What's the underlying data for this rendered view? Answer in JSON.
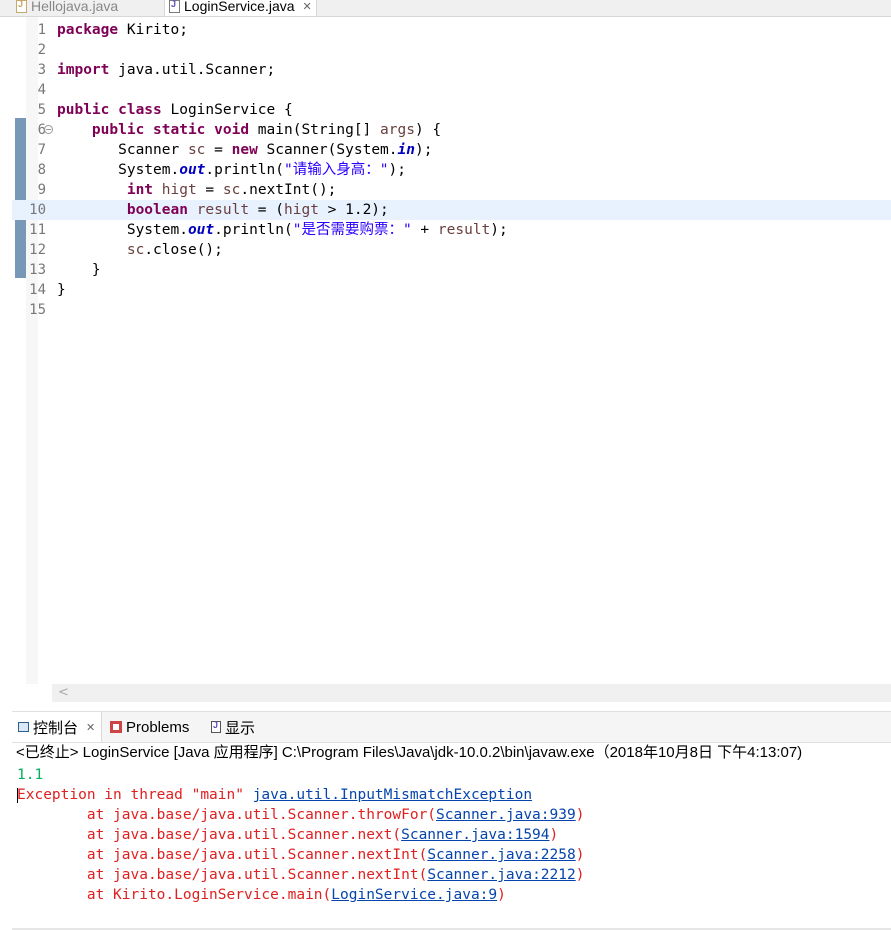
{
  "editor_tabs": [
    {
      "label": "Hellojava.java",
      "active": false,
      "icon": "java-file-icon"
    },
    {
      "label": "LoginService.java",
      "active": true,
      "icon": "java-file-icon",
      "close": "✕"
    }
  ],
  "code_lines": [
    {
      "n": "1",
      "tokens": [
        {
          "t": "kw",
          "v": "package"
        },
        {
          "t": "p",
          "v": " Kirito;"
        }
      ]
    },
    {
      "n": "2",
      "tokens": []
    },
    {
      "n": "3",
      "tokens": [
        {
          "t": "kw",
          "v": "import"
        },
        {
          "t": "p",
          "v": " java.util.Scanner;"
        }
      ]
    },
    {
      "n": "4",
      "tokens": []
    },
    {
      "n": "5",
      "tokens": [
        {
          "t": "kw",
          "v": "public class"
        },
        {
          "t": "p",
          "v": " LoginService {"
        }
      ]
    },
    {
      "n": "6",
      "fold": "−",
      "tokens": [
        {
          "t": "p",
          "v": "    "
        },
        {
          "t": "kw",
          "v": "public static void"
        },
        {
          "t": "p",
          "v": " main(String[] "
        },
        {
          "t": "var",
          "v": "args"
        },
        {
          "t": "p",
          "v": ") {"
        }
      ]
    },
    {
      "n": "7",
      "tokens": [
        {
          "t": "p",
          "v": "       Scanner "
        },
        {
          "t": "var",
          "v": "sc"
        },
        {
          "t": "p",
          "v": " = "
        },
        {
          "t": "kw",
          "v": "new"
        },
        {
          "t": "p",
          "v": " Scanner(System."
        },
        {
          "t": "fld",
          "v": "in"
        },
        {
          "t": "p",
          "v": ");"
        }
      ]
    },
    {
      "n": "8",
      "tokens": [
        {
          "t": "p",
          "v": "       System."
        },
        {
          "t": "fld",
          "v": "out"
        },
        {
          "t": "p",
          "v": ".println("
        },
        {
          "t": "str",
          "v": "\"请输入身高：\""
        },
        {
          "t": "p",
          "v": ");"
        }
      ]
    },
    {
      "n": "9",
      "tokens": [
        {
          "t": "p",
          "v": "        "
        },
        {
          "t": "kw",
          "v": "int"
        },
        {
          "t": "p",
          "v": " "
        },
        {
          "t": "var",
          "v": "higt"
        },
        {
          "t": "p",
          "v": " = "
        },
        {
          "t": "var",
          "v": "sc"
        },
        {
          "t": "p",
          "v": ".nextInt();"
        }
      ]
    },
    {
      "n": "10",
      "current": true,
      "tokens": [
        {
          "t": "p",
          "v": "        "
        },
        {
          "t": "kw",
          "v": "boolean"
        },
        {
          "t": "p",
          "v": " "
        },
        {
          "t": "var",
          "v": "result"
        },
        {
          "t": "p",
          "v": " = ("
        },
        {
          "t": "var",
          "v": "higt"
        },
        {
          "t": "p",
          "v": " > 1.2);"
        }
      ]
    },
    {
      "n": "11",
      "tokens": [
        {
          "t": "p",
          "v": "        System."
        },
        {
          "t": "fld",
          "v": "out"
        },
        {
          "t": "p",
          "v": ".println("
        },
        {
          "t": "str",
          "v": "\"是否需要购票：\""
        },
        {
          "t": "p",
          "v": " + "
        },
        {
          "t": "var",
          "v": "result"
        },
        {
          "t": "p",
          "v": ");"
        }
      ]
    },
    {
      "n": "12",
      "tokens": [
        {
          "t": "p",
          "v": "        "
        },
        {
          "t": "var",
          "v": "sc"
        },
        {
          "t": "p",
          "v": ".close();"
        }
      ]
    },
    {
      "n": "13",
      "tokens": [
        {
          "t": "p",
          "v": "    }"
        }
      ]
    },
    {
      "n": "14",
      "tokens": [
        {
          "t": "p",
          "v": "}"
        }
      ]
    },
    {
      "n": "15",
      "tokens": []
    }
  ],
  "scroll_left_arrow": "<",
  "console_tabs": [
    {
      "label": "控制台",
      "icon": "console-icon",
      "close": "✕",
      "active": true
    },
    {
      "label": "Problems",
      "icon": "problems-icon"
    },
    {
      "label": "显示",
      "icon": "display-icon"
    }
  ],
  "console_header": "<已终止> LoginService [Java 应用程序] C:\\Program Files\\Java\\jdk-10.0.2\\bin\\javaw.exe（2018年10月8日 下午4:13:07)",
  "console_lines": [
    {
      "kind": "input",
      "parts": [
        {
          "t": "p",
          "v": "1.1"
        }
      ]
    },
    {
      "kind": "err",
      "caret": true,
      "parts": [
        {
          "t": "p",
          "v": "Exception in thread \"main\" "
        },
        {
          "t": "link",
          "v": "java.util.InputMismatchException"
        }
      ]
    },
    {
      "kind": "err",
      "parts": [
        {
          "t": "p",
          "v": "\tat java.base/java.util.Scanner.throwFor("
        },
        {
          "t": "link",
          "v": "Scanner.java:939"
        },
        {
          "t": "p",
          "v": ")"
        }
      ]
    },
    {
      "kind": "err",
      "parts": [
        {
          "t": "p",
          "v": "\tat java.base/java.util.Scanner.next("
        },
        {
          "t": "link",
          "v": "Scanner.java:1594"
        },
        {
          "t": "p",
          "v": ")"
        }
      ]
    },
    {
      "kind": "err",
      "parts": [
        {
          "t": "p",
          "v": "\tat java.base/java.util.Scanner.nextInt("
        },
        {
          "t": "link",
          "v": "Scanner.java:2258"
        },
        {
          "t": "p",
          "v": ")"
        }
      ]
    },
    {
      "kind": "err",
      "parts": [
        {
          "t": "p",
          "v": "\tat java.base/java.util.Scanner.nextInt("
        },
        {
          "t": "link",
          "v": "Scanner.java:2212"
        },
        {
          "t": "p",
          "v": ")"
        }
      ]
    },
    {
      "kind": "err",
      "parts": [
        {
          "t": "p",
          "v": "\tat Kirito.LoginService.main("
        },
        {
          "t": "link",
          "v": "LoginService.java:9"
        },
        {
          "t": "p",
          "v": ")"
        }
      ]
    }
  ]
}
